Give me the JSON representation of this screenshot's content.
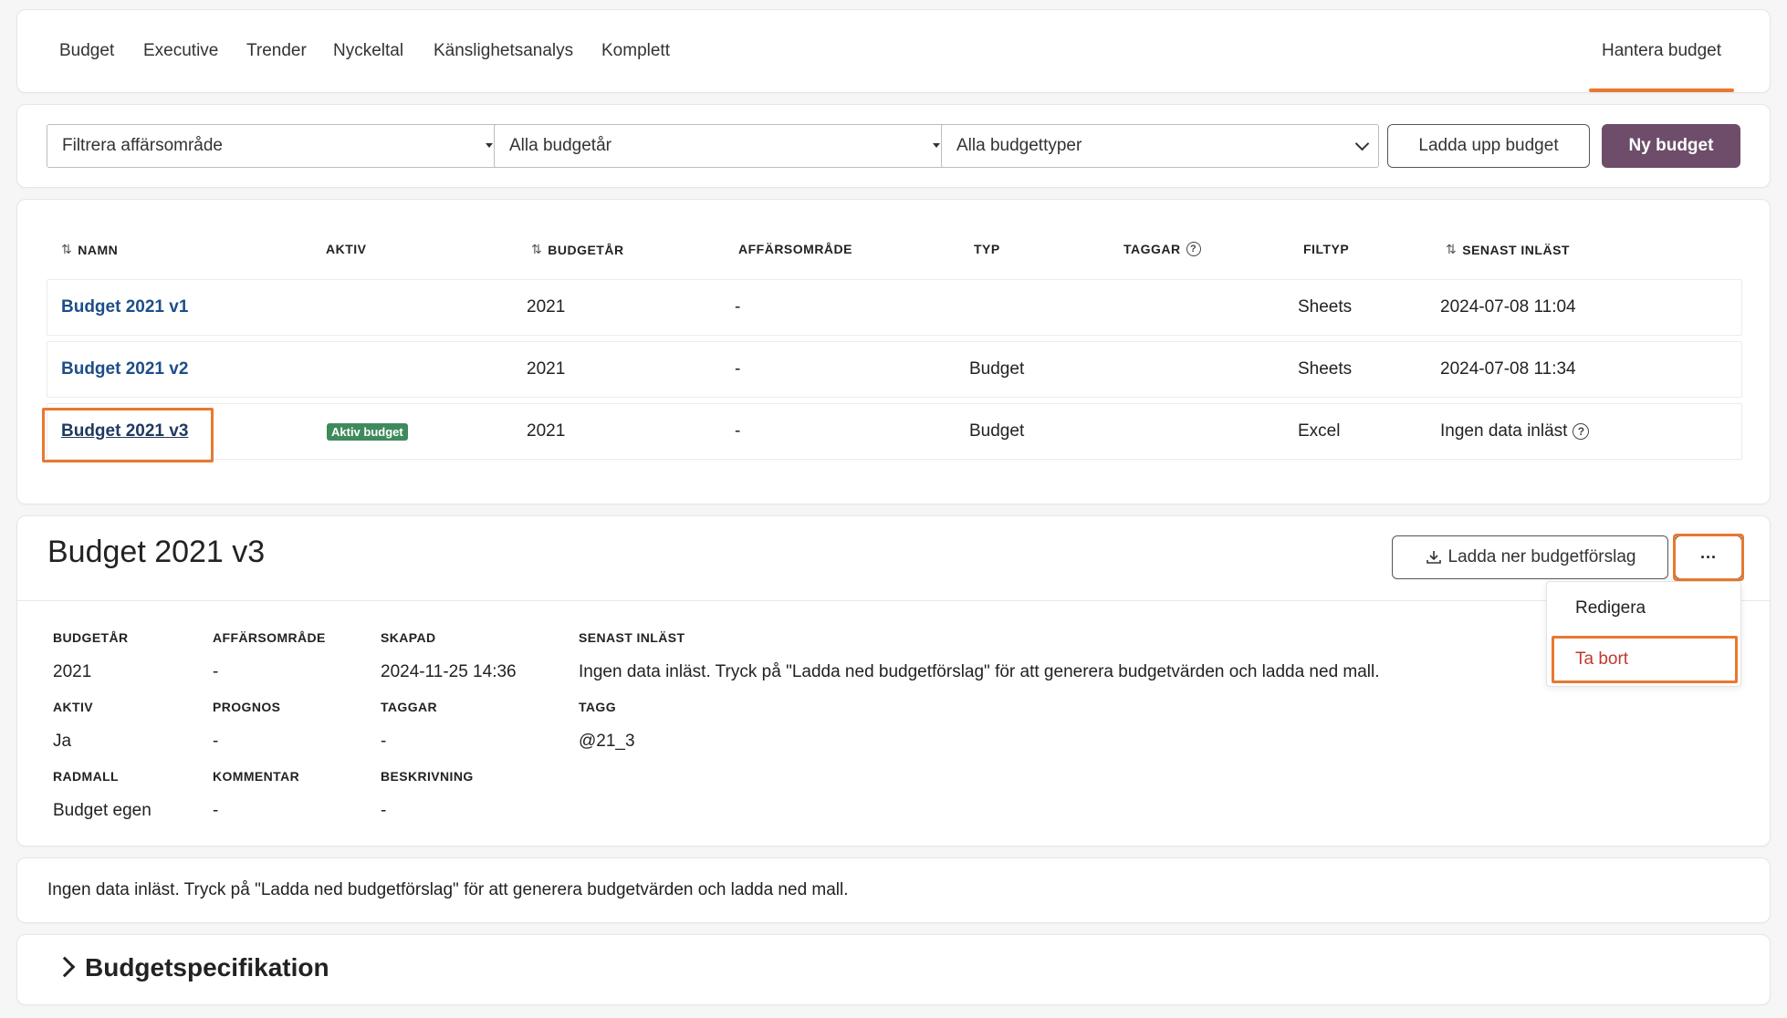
{
  "nav": {
    "tabs": [
      "Budget",
      "Executive",
      "Trender",
      "Nyckeltal",
      "Känslighetsanalys",
      "Komplett"
    ],
    "active_tab": "Hantera budget"
  },
  "filters": {
    "business_area": "Filtrera affärsområde",
    "budget_year": "Alla budgetår",
    "budget_type": "Alla budgettyper",
    "upload_button": "Ladda upp budget",
    "new_button": "Ny budget"
  },
  "table": {
    "headers": {
      "name": "NAMN",
      "active": "AKTIV",
      "year": "BUDGETÅR",
      "area": "AFFÄRSOMRÅDE",
      "type": "TYP",
      "tags": "TAGGAR",
      "filetype": "FILTYP",
      "last_loaded": "SENAST INLÄST"
    },
    "rows": [
      {
        "name": "Budget 2021 v1",
        "active": "",
        "year": "2021",
        "area": "-",
        "type": "",
        "filetype": "Sheets",
        "last_loaded": "2024-07-08 11:04"
      },
      {
        "name": "Budget 2021 v2",
        "active": "",
        "year": "2021",
        "area": "-",
        "type": "Budget",
        "filetype": "Sheets",
        "last_loaded": "2024-07-08 11:34"
      },
      {
        "name": "Budget 2021 v3",
        "active": "Aktiv budget",
        "year": "2021",
        "area": "-",
        "type": "Budget",
        "filetype": "Excel",
        "last_loaded": "Ingen data inläst"
      }
    ]
  },
  "detail": {
    "title": "Budget 2021 v3",
    "download_button": "Ladda ner budgetförslag",
    "more_button": "···",
    "fields": {
      "year_label": "BUDGETÅR",
      "year_value": "2021",
      "area_label": "AFFÄRSOMRÅDE",
      "area_value": "-",
      "created_label": "SKAPAD",
      "created_value": "2024-11-25 14:36",
      "last_loaded_label": "SENAST INLÄST",
      "last_loaded_value": "Ingen data inläst. Tryck på \"Ladda ned budgetförslag\" för att generera budgetvärden och ladda ned mall.",
      "active_label": "AKTIV",
      "active_value": "Ja",
      "forecast_label": "PROGNOS",
      "forecast_value": "-",
      "tags_label": "TAGGAR",
      "tags_value": "-",
      "tag_label": "TAGG",
      "tag_value": "@21_3",
      "template_label": "RADMALL",
      "template_value": "Budget egen",
      "comment_label": "KOMMENTAR",
      "comment_value": "-",
      "description_label": "BESKRIVNING",
      "description_value": "-"
    }
  },
  "menu": {
    "edit": "Redigera",
    "delete": "Ta bort"
  },
  "info": {
    "text": "Ingen data inläst. Tryck på \"Ladda ned budgetförslag\" för att generera budgetvärden och ladda ned mall."
  },
  "spec": {
    "title": "Budgetspecifikation"
  },
  "colors": {
    "accent": "#e8782f",
    "primary": "#6d4d6a",
    "badge": "#3f8a5c",
    "link": "#1d4e89",
    "danger": "#c0392b"
  }
}
